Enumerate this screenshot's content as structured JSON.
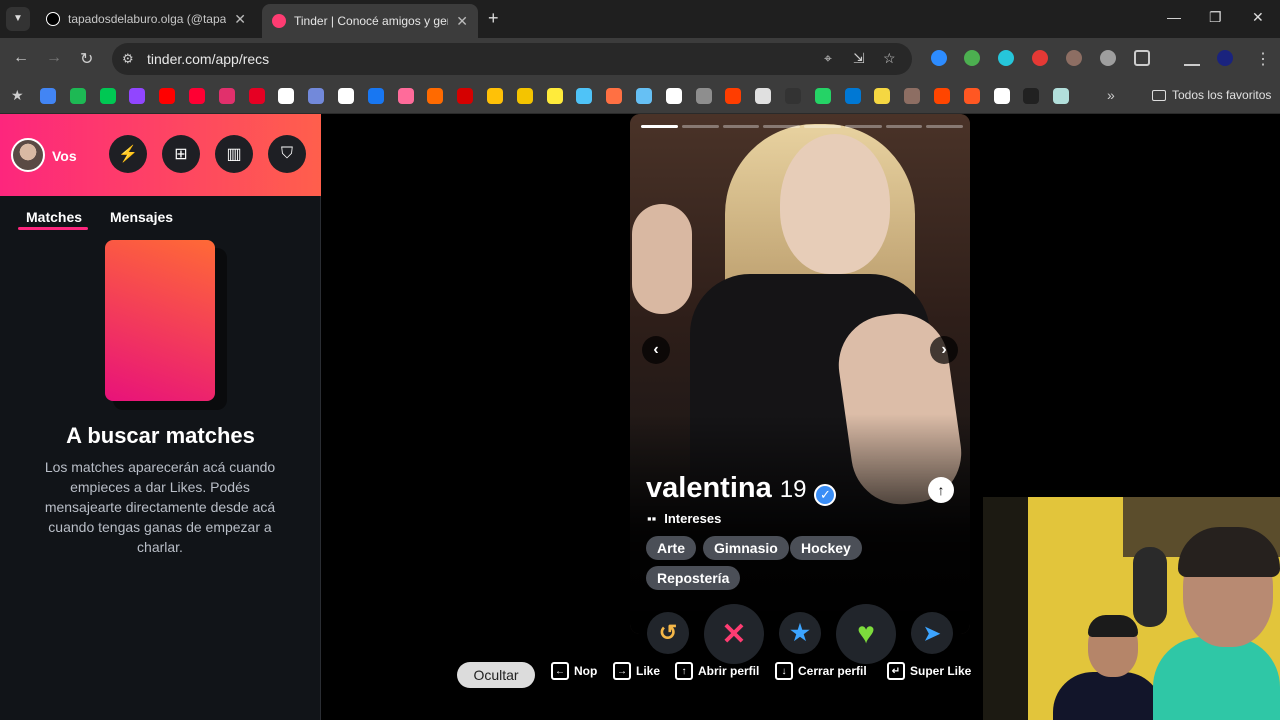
{
  "browser": {
    "tabs": [
      {
        "title": "tapadosdelaburo.olga (@tapadosdelaburo.olga)",
        "favicon_color": "#ffffff",
        "active": false
      },
      {
        "title": "Tinder | Conocé amigos y gente nueva",
        "favicon_color": "#fe3c72",
        "active": true
      }
    ],
    "url": "tinder.com/app/recs",
    "bookmarks_folder": "Todos los favoritos",
    "bookmark_colors": [
      "#4285f4",
      "#1db954",
      "#00c853",
      "#9146ff",
      "#ff0000",
      "#ff0033",
      "#e1306c",
      "#e60023",
      "#ffffff",
      "#7289da",
      "#ffffff",
      "#1877f2",
      "#ff6b9a",
      "#ff6a00",
      "#d50000",
      "#ffc107",
      "#f4c400",
      "#ffeb3b",
      "#4fc3f7",
      "#ff7043",
      "#66c0f4",
      "#ffffff",
      "#8e8e8e",
      "#ff3d00",
      "#e0e0e0",
      "#333333",
      "#25d366",
      "#0078d4",
      "#f5d742",
      "#8d6e63",
      "#ff4500",
      "#ff5722",
      "#ffffff",
      "#212121",
      "#b2dfdb"
    ]
  },
  "sidebar": {
    "user_label": "Vos",
    "tabs": [
      {
        "label": "Matches",
        "active": true
      },
      {
        "label": "Mensajes",
        "active": false
      }
    ],
    "empty_title": "A buscar matches",
    "empty_text": "Los matches aparecerán acá cuando empieces a dar Likes. Podés mensajearte directamente desde acá cuando tengas ganas de empezar a charlar.",
    "accent_gradient": [
      "#fd267d",
      "#ff5f4c"
    ]
  },
  "profile": {
    "name": "valentina",
    "age": "19",
    "verified": true,
    "photo_count": 8,
    "current_photo": 1,
    "interests_label": "Intereses",
    "interests": [
      "Arte",
      "Gimnasio",
      "Hockey",
      "Repostería"
    ]
  },
  "actions": [
    {
      "name": "rewind",
      "glyph": "↺",
      "color": "#f5b748"
    },
    {
      "name": "nope",
      "glyph": "✕",
      "color": "#fe3c72"
    },
    {
      "name": "super-like",
      "glyph": "★",
      "color": "#3ca4ff"
    },
    {
      "name": "like",
      "glyph": "♥",
      "color": "#7ddc3c"
    },
    {
      "name": "boost",
      "glyph": "➤",
      "color": "#3ca4ff"
    }
  ],
  "shortcuts": {
    "hide_label": "Ocultar",
    "items": [
      {
        "key": "←",
        "label": "Nop"
      },
      {
        "key": "→",
        "label": "Like"
      },
      {
        "key": "↑",
        "label": "Abrir perfil"
      },
      {
        "key": "↓",
        "label": "Cerrar perfil"
      },
      {
        "key": "↵",
        "label": "Super Like"
      }
    ]
  }
}
